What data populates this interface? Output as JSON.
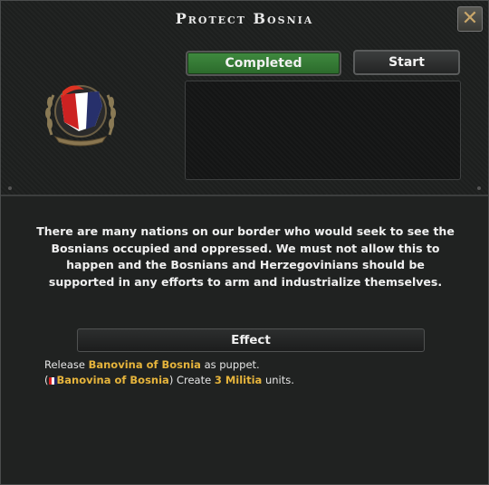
{
  "window": {
    "title": "Protect Bosnia"
  },
  "buttons": {
    "close": "✕",
    "completed": "Completed",
    "start": "Start"
  },
  "description": "There are many nations on our border who would seek to see the Bosnians occupied and oppressed. We must not allow this to happen and the Bosnians and Herzegovinians should be supported in any efforts to arm and industrialize themselves.",
  "effect": {
    "label": "Effect",
    "line1": {
      "prefix": "Release",
      "country": "Banovina of Bosnia",
      "suffix": "as puppet."
    },
    "line2": {
      "open": "(",
      "country": "Banovina of Bosnia",
      "close_pre": ") Create",
      "count_unit": "3 Militia",
      "suffix": "units."
    }
  },
  "colors": {
    "completed_green": "#3f8a3f",
    "highlight_gold": "#e6b43c"
  },
  "icons": {
    "focus_emblem": "bosnia-focus-emblem",
    "close": "close-icon"
  }
}
